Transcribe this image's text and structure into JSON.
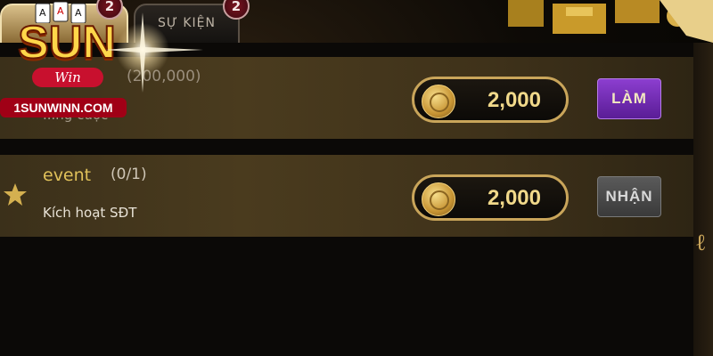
{
  "tabs": [
    {
      "label": "",
      "badge": "2",
      "active": true
    },
    {
      "label": "SỰ KIỆN",
      "badge": "2",
      "active": false
    }
  ],
  "logo": {
    "brand": "SUN",
    "sub": "Win",
    "site": "1SUNWINN.COM"
  },
  "tasks": [
    {
      "title": "",
      "progress": "(200,000)",
      "description": "...ng cược",
      "reward": "2,000",
      "button_label": "LÀM"
    },
    {
      "title": "event",
      "progress": "(0/1)",
      "description": "Kích hoạt SĐT",
      "reward": "2,000",
      "button_label": "NHẬN"
    }
  ],
  "colors": {
    "accent_gold": "#c9a55a",
    "button_do": "#6f2bb3",
    "button_claim": "#4a4a4a",
    "row_bg": "#3f321a"
  },
  "icons": [
    "coin-icon",
    "star-icon",
    "sparkle-icon"
  ]
}
